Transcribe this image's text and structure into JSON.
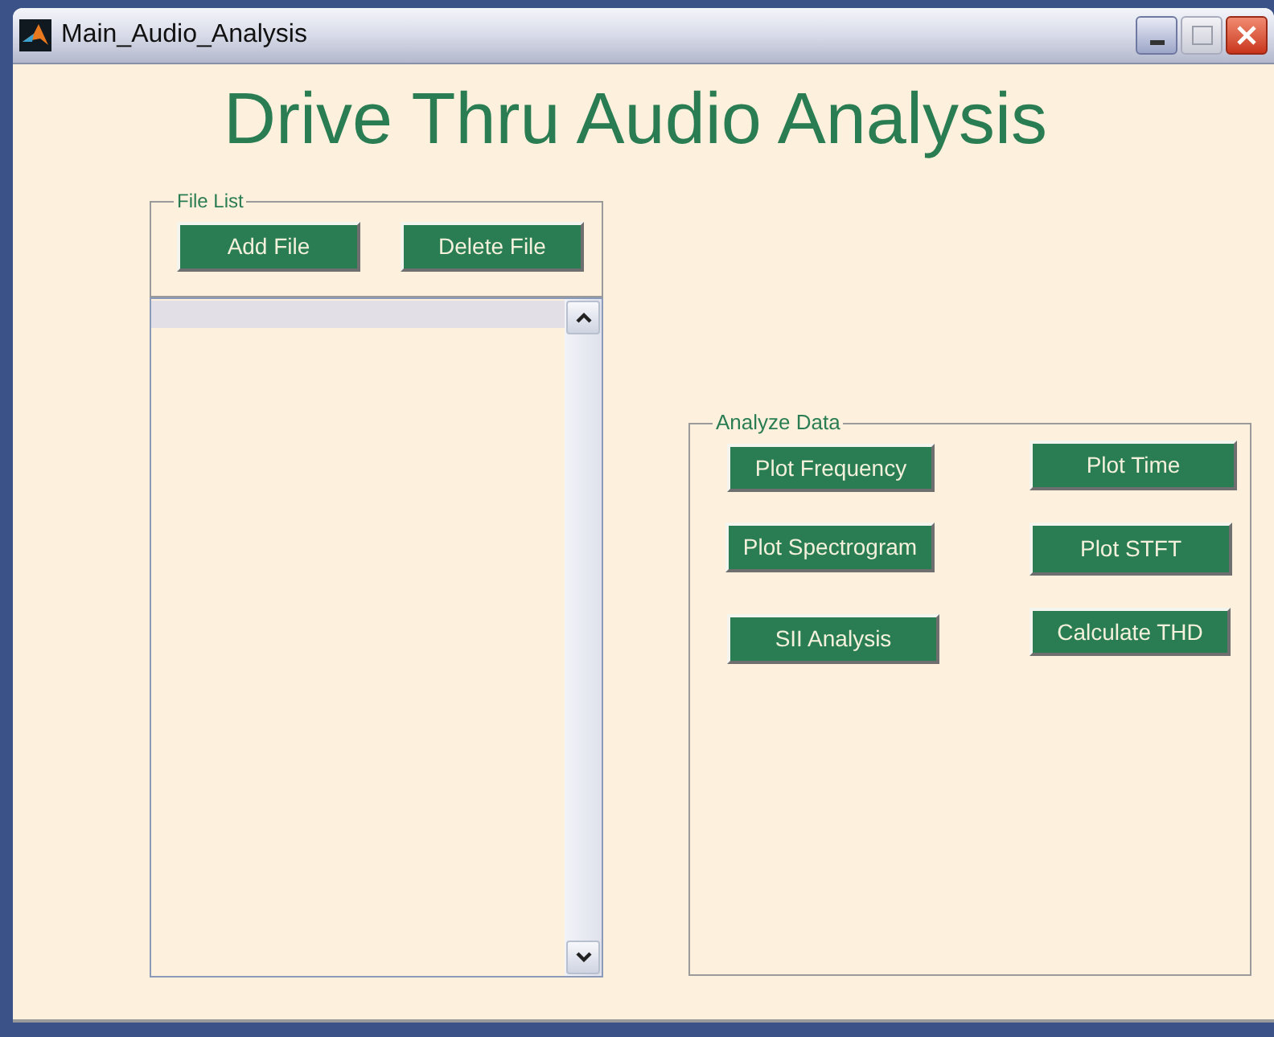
{
  "window": {
    "title": "Main_Audio_Analysis"
  },
  "heading": "Drive Thru Audio Analysis",
  "file_list": {
    "title": "File List",
    "buttons": [
      "Add File",
      "Delete File"
    ]
  },
  "analyze_data": {
    "title": "Analyze Data",
    "buttons": [
      "Plot Frequency",
      "Plot Time",
      "Plot Spectrogram",
      "Plot STFT",
      "SII Analysis",
      "Calculate THD"
    ]
  }
}
